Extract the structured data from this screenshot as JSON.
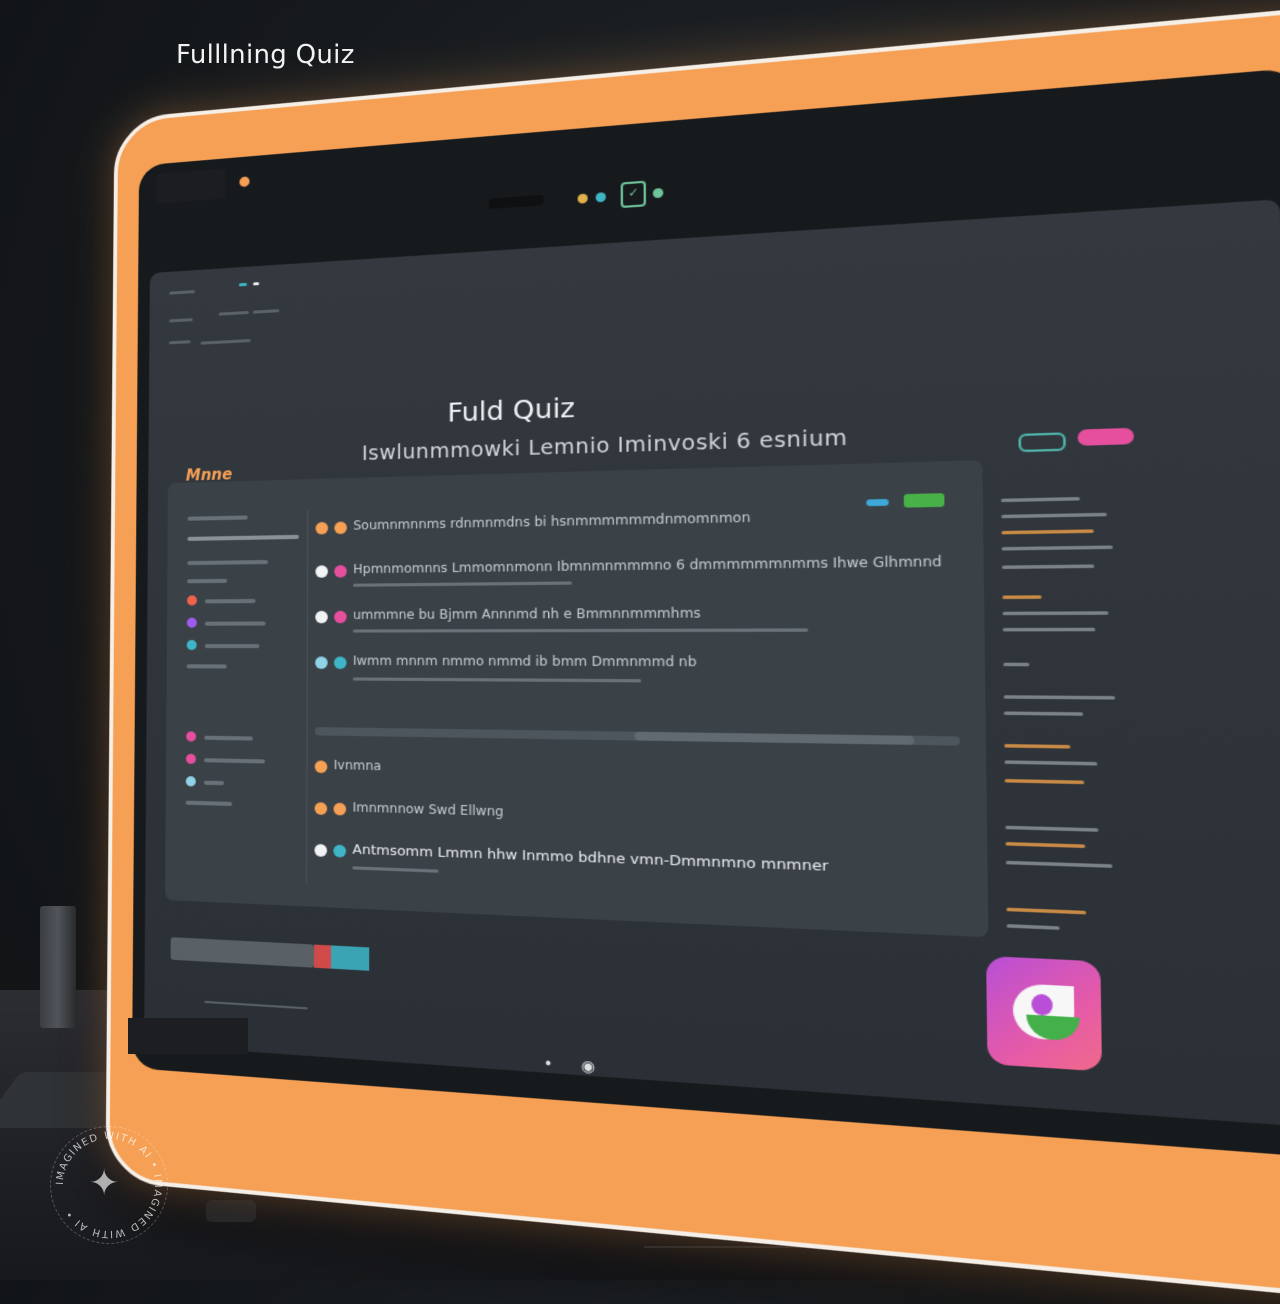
{
  "page": {
    "title": "Fulllning Quiz"
  },
  "app": {
    "title": "Fuld Quiz",
    "subtitle": "Iswlunmmowki Lemnio Iminvoski 6 esnium",
    "brand": "Mnne"
  },
  "questions": [
    {
      "text": "Soumnmnnms  rdnmnmdns  bi hsnmmmmmmdnmomnmon",
      "radio_color": "#f6a055",
      "dot_color": "#f6a055"
    },
    {
      "text": "Hpmnmomnns  Lmmomnmonn  Ibmnmnmmmno 6 dmmmmmmnmms  Ihwe  Glhmnnd",
      "radio_color": "#f1f3f5",
      "dot_color": "#e64f9e"
    },
    {
      "text": "ummmne  bu  Bjmm Annnmd  nh  e Bmmnnmmmhms",
      "radio_color": "#f1f3f5",
      "dot_color": "#e64f9e"
    },
    {
      "text": "Iwmm  mnnm nmmo nmmd  ib  bmm  Dmmnmmd nb",
      "radio_color": "#8fd3e8",
      "dot_color": "#3fb6c8"
    },
    {
      "text": "Ivnmna",
      "radio_color": "#f6a055",
      "dot_color": "#f6a055"
    },
    {
      "text": "Imnmnnow  Swd  Ellwng",
      "radio_color": "#f6a055",
      "dot_color": "#f6a055"
    },
    {
      "text": "Antmsomm Lmmn hhw Inmmo bdhne vmn-Dmmnmno mnmner",
      "radio_color": "#f1f3f5",
      "dot_color": "#3fb6c8"
    }
  ],
  "icons": {
    "app_icon": "leaf-app-icon",
    "camera": "camera-icon",
    "settings": "square-icon"
  },
  "colors": {
    "bezel": "#f6a055",
    "accent_pink": "#e64f9e",
    "accent_green": "#48b248",
    "accent_teal": "#3fb6c8"
  },
  "watermark": {
    "text": "IMAGINED WITH AI • IMAGINED WITH AI •"
  }
}
